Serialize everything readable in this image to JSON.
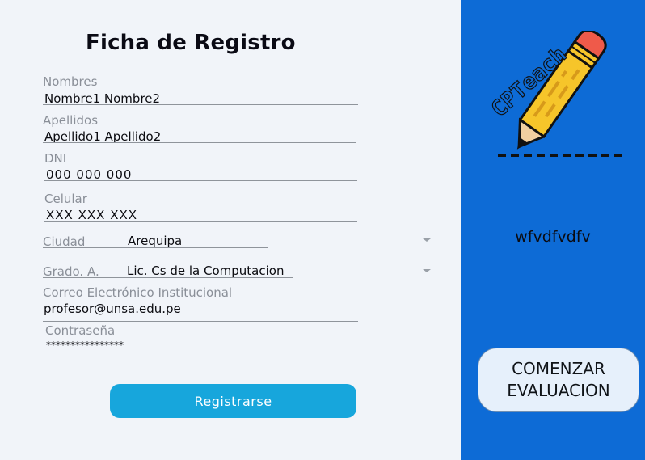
{
  "form": {
    "title": "Ficha de Registro",
    "fields": {
      "nombres": {
        "label": "Nombres",
        "value": "Nombre1 Nombre2"
      },
      "apellidos": {
        "label": "Apellidos",
        "value": "Apellido1 Apellido2"
      },
      "dni": {
        "label": "DNI",
        "value": "000 000 000"
      },
      "celular": {
        "label": "Celular",
        "value": "XXX XXX XXX"
      },
      "ciudad": {
        "label": "Ciudad",
        "value": "Arequipa"
      },
      "grado": {
        "label": "Grado. A.",
        "value": "Lic. Cs de la Computacion"
      },
      "correo": {
        "label": "Correo Electrónico Institucional",
        "value": "profesor@unsa.edu.pe"
      },
      "contrasena": {
        "label": "Contraseña",
        "value": "****************"
      }
    },
    "register_label": "Registrarse"
  },
  "sidebar": {
    "logo_text": "CPTeach",
    "text": "wfvdfvdfv",
    "start_label_line1": "COMENZAR",
    "start_label_line2": "EVALUACION"
  },
  "colors": {
    "sidebar_bg": "#0d6bd6",
    "register_button": "#17a6dc",
    "start_button": "#e6f0fb",
    "pencil_body": "#f6c52a",
    "pencil_eraser": "#ef5a4a"
  },
  "icons": [
    "pencil-logo-icon",
    "chevron-down-icon"
  ]
}
